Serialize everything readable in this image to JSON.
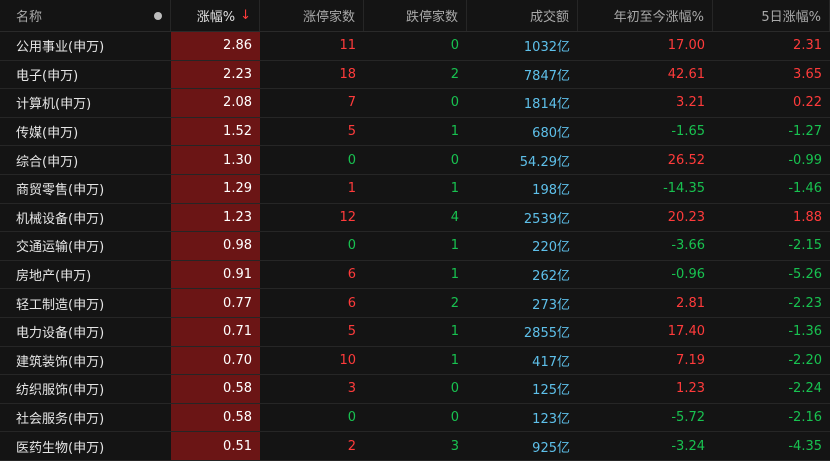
{
  "headers": {
    "name": "名称",
    "change": "涨幅%",
    "change_arrow": "↓",
    "limit_up": "涨停家数",
    "limit_down": "跌停家数",
    "volume": "成交额",
    "ytd": "年初至今涨幅%",
    "five_day": "5日涨幅%"
  },
  "colors": {
    "up": "#ff3b3b",
    "down": "#18c250",
    "volume": "#5ec0ea",
    "highlight": "#6b1515"
  },
  "rows": [
    {
      "name": "公用事业(申万)",
      "change": "2.86",
      "limit_up": "11",
      "limit_down": "0",
      "volume": "1032亿",
      "ytd": "17.00",
      "five_day": "2.31"
    },
    {
      "name": "电子(申万)",
      "change": "2.23",
      "limit_up": "18",
      "limit_down": "2",
      "volume": "7847亿",
      "ytd": "42.61",
      "five_day": "3.65"
    },
    {
      "name": "计算机(申万)",
      "change": "2.08",
      "limit_up": "7",
      "limit_down": "0",
      "volume": "1814亿",
      "ytd": "3.21",
      "five_day": "0.22"
    },
    {
      "name": "传媒(申万)",
      "change": "1.52",
      "limit_up": "5",
      "limit_down": "1",
      "volume": "680亿",
      "ytd": "-1.65",
      "five_day": "-1.27"
    },
    {
      "name": "综合(申万)",
      "change": "1.30",
      "limit_up": "0",
      "limit_down": "0",
      "volume": "54.29亿",
      "ytd": "26.52",
      "five_day": "-0.99"
    },
    {
      "name": "商贸零售(申万)",
      "change": "1.29",
      "limit_up": "1",
      "limit_down": "1",
      "volume": "198亿",
      "ytd": "-14.35",
      "five_day": "-1.46"
    },
    {
      "name": "机械设备(申万)",
      "change": "1.23",
      "limit_up": "12",
      "limit_down": "4",
      "volume": "2539亿",
      "ytd": "20.23",
      "five_day": "1.88"
    },
    {
      "name": "交通运输(申万)",
      "change": "0.98",
      "limit_up": "0",
      "limit_down": "1",
      "volume": "220亿",
      "ytd": "-3.66",
      "five_day": "-2.15"
    },
    {
      "name": "房地产(申万)",
      "change": "0.91",
      "limit_up": "6",
      "limit_down": "1",
      "volume": "262亿",
      "ytd": "-0.96",
      "five_day": "-5.26"
    },
    {
      "name": "轻工制造(申万)",
      "change": "0.77",
      "limit_up": "6",
      "limit_down": "2",
      "volume": "273亿",
      "ytd": "2.81",
      "five_day": "-2.23"
    },
    {
      "name": "电力设备(申万)",
      "change": "0.71",
      "limit_up": "5",
      "limit_down": "1",
      "volume": "2855亿",
      "ytd": "17.40",
      "five_day": "-1.36"
    },
    {
      "name": "建筑装饰(申万)",
      "change": "0.70",
      "limit_up": "10",
      "limit_down": "1",
      "volume": "417亿",
      "ytd": "7.19",
      "five_day": "-2.20"
    },
    {
      "name": "纺织服饰(申万)",
      "change": "0.58",
      "limit_up": "3",
      "limit_down": "0",
      "volume": "125亿",
      "ytd": "1.23",
      "five_day": "-2.24"
    },
    {
      "name": "社会服务(申万)",
      "change": "0.58",
      "limit_up": "0",
      "limit_down": "0",
      "volume": "123亿",
      "ytd": "-5.72",
      "five_day": "-2.16"
    },
    {
      "name": "医药生物(申万)",
      "change": "0.51",
      "limit_up": "2",
      "limit_down": "3",
      "volume": "925亿",
      "ytd": "-3.24",
      "five_day": "-4.35"
    }
  ]
}
